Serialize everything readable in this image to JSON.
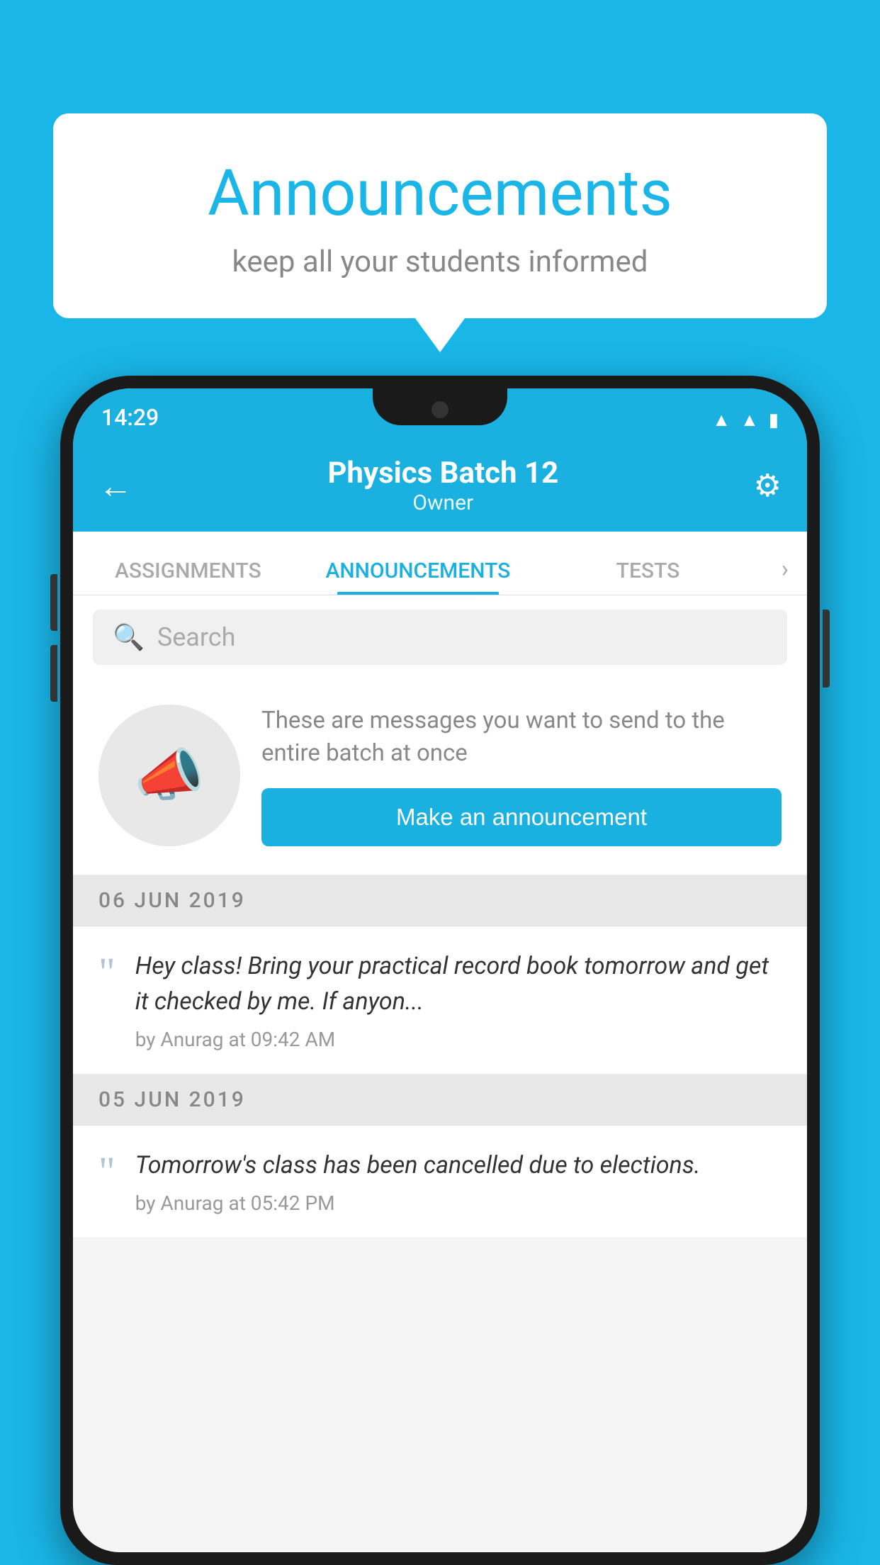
{
  "background_color": "#1ab6e8",
  "speech_bubble": {
    "title": "Announcements",
    "subtitle": "keep all your students informed"
  },
  "phone": {
    "status_bar": {
      "time": "14:29"
    },
    "app_bar": {
      "title": "Physics Batch 12",
      "subtitle": "Owner",
      "back_label": "←",
      "gear_label": "⚙"
    },
    "tabs": [
      {
        "label": "ASSIGNMENTS",
        "active": false
      },
      {
        "label": "ANNOUNCEMENTS",
        "active": true
      },
      {
        "label": "TESTS",
        "active": false
      }
    ],
    "search": {
      "placeholder": "Search"
    },
    "announcement_prompt": {
      "description": "These are messages you want to send to the entire batch at once",
      "button_label": "Make an announcement"
    },
    "announcements": [
      {
        "date": "06  JUN  2019",
        "text": "Hey class! Bring your practical record book tomorrow and get it checked by me. If anyon...",
        "meta": "by Anurag at 09:42 AM"
      },
      {
        "date": "05  JUN  2019",
        "text": "Tomorrow's class has been cancelled due to elections.",
        "meta": "by Anurag at 05:42 PM"
      }
    ]
  }
}
